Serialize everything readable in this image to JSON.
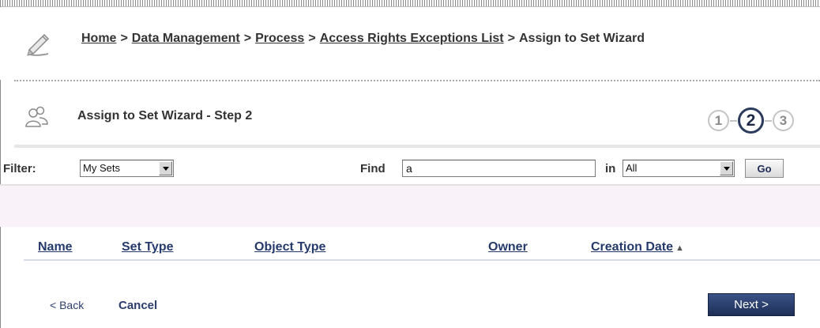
{
  "breadcrumb": {
    "items": [
      {
        "label": "Home",
        "link": true
      },
      {
        "label": "Data Management",
        "link": true
      },
      {
        "label": "Process",
        "link": true
      },
      {
        "label": "Access Rights Exceptions List",
        "link": true
      },
      {
        "label": "Assign to Set Wizard",
        "link": false
      }
    ],
    "separator": ">"
  },
  "wizard": {
    "title": "Assign to Set Wizard - Step 2",
    "steps": [
      "1",
      "2",
      "3"
    ],
    "active_step": 2
  },
  "filter": {
    "label": "Filter:",
    "selected": "My Sets",
    "find_label": "Find",
    "find_value": "a",
    "in_label": "in",
    "in_selected": "All",
    "go_label": "Go"
  },
  "table": {
    "columns": [
      "Name",
      "Set Type",
      "Object Type",
      "Owner",
      "Creation Date"
    ],
    "sorted_column": "Creation Date",
    "sort_direction": "ascending",
    "rows": []
  },
  "footer": {
    "back_label": "< Back",
    "cancel_label": "Cancel",
    "next_label": "Next >"
  },
  "colors": {
    "link": "#243a6c",
    "next_button": "#25375f",
    "pink_band": "#faf2f9",
    "active_step": "#2b3b5e"
  }
}
